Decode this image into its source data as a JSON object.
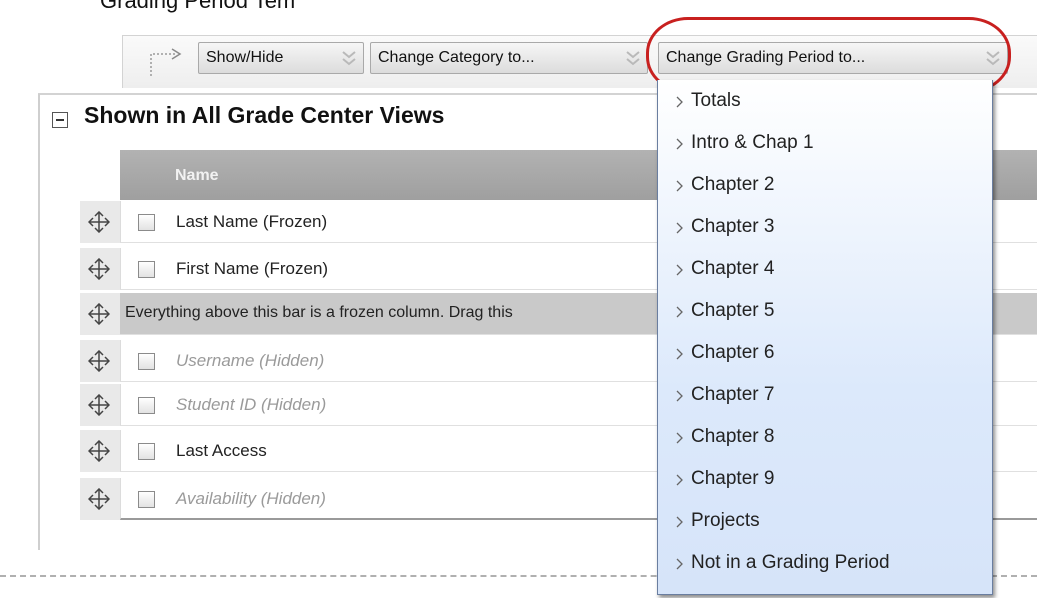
{
  "page": {
    "heading": "Grading Period Tem"
  },
  "action_bar": {
    "show_hide_label": "Show/Hide",
    "change_category_label": "Change Category to...",
    "change_grading_period_label": "Change Grading Period to..."
  },
  "section": {
    "title": "Shown in All Grade Center Views"
  },
  "table": {
    "header": "Name",
    "rows": [
      {
        "label": "Last Name (Frozen)",
        "hidden": false
      },
      {
        "label": "First Name (Frozen)",
        "hidden": false
      },
      {
        "label": "Everything above this bar is a frozen column. Drag this",
        "bar_tail": "froz"
      },
      {
        "label": "Username (Hidden)",
        "hidden": true
      },
      {
        "label": "Student ID (Hidden)",
        "hidden": true
      },
      {
        "label": "Last Access",
        "hidden": false
      },
      {
        "label": "Availability (Hidden)",
        "hidden": true
      }
    ]
  },
  "dropdown": {
    "items": [
      "Totals",
      "Intro & Chap 1",
      "Chapter 2",
      "Chapter 3",
      "Chapter 4",
      "Chapter 5",
      "Chapter 6",
      "Chapter 7",
      "Chapter 8",
      "Chapter 9",
      "Projects",
      "Not in a Grading Period"
    ]
  },
  "colors": {
    "highlight_ring": "#c8201f",
    "dropdown_border": "#6a7ea0",
    "dropdown_bg": "#dce9fb",
    "table_header_bg": "#a8a8a8",
    "frozen_bar_bg": "#c9c9c9",
    "hidden_text": "#9a9a9a"
  },
  "icons": {
    "action_arrow": "corner-arrow-icon",
    "button_chevron": "double-chevron-down-icon",
    "collapse": "collapse-minus-icon",
    "row_handle": "move-arrows-icon",
    "menu_caret": "caret-right-icon"
  }
}
